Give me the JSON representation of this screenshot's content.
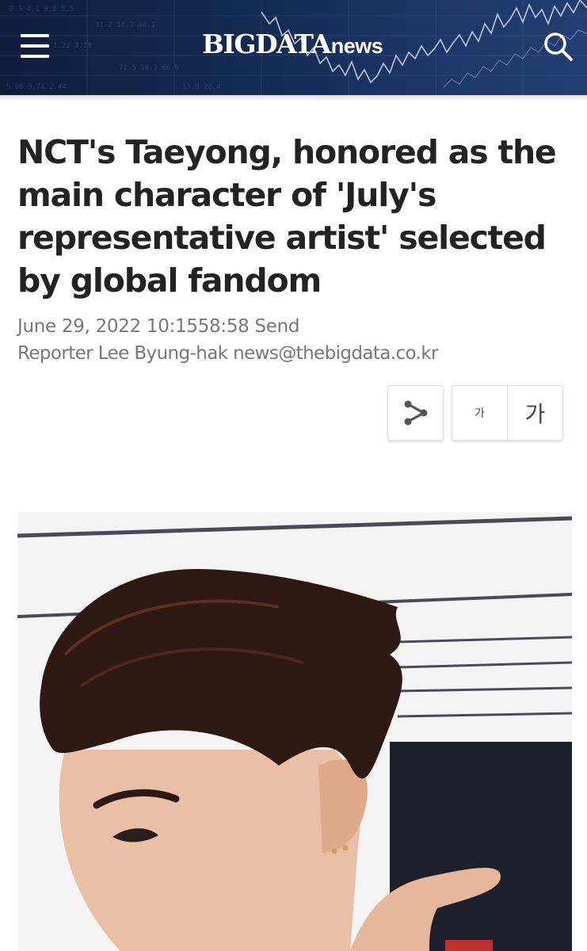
{
  "header": {
    "logo_main": "BIGDATA",
    "logo_sub": "news",
    "menu_icon": "hamburger-menu-icon",
    "search_icon": "search-icon",
    "background_color": "#14284f"
  },
  "article": {
    "title": "NCT's Taeyong, honored as the main character of 'July's representative artist' selected by global fandom",
    "date": "June 29, 2022 10:1558:58 Send",
    "reporter": "Reporter Lee Byung-hak news@thebigdata.co.kr"
  },
  "tools": {
    "share_icon": "share-icon",
    "font_small_label": "가",
    "font_large_label": "가"
  },
  "photo": {
    "image_icon": "article-photo"
  }
}
